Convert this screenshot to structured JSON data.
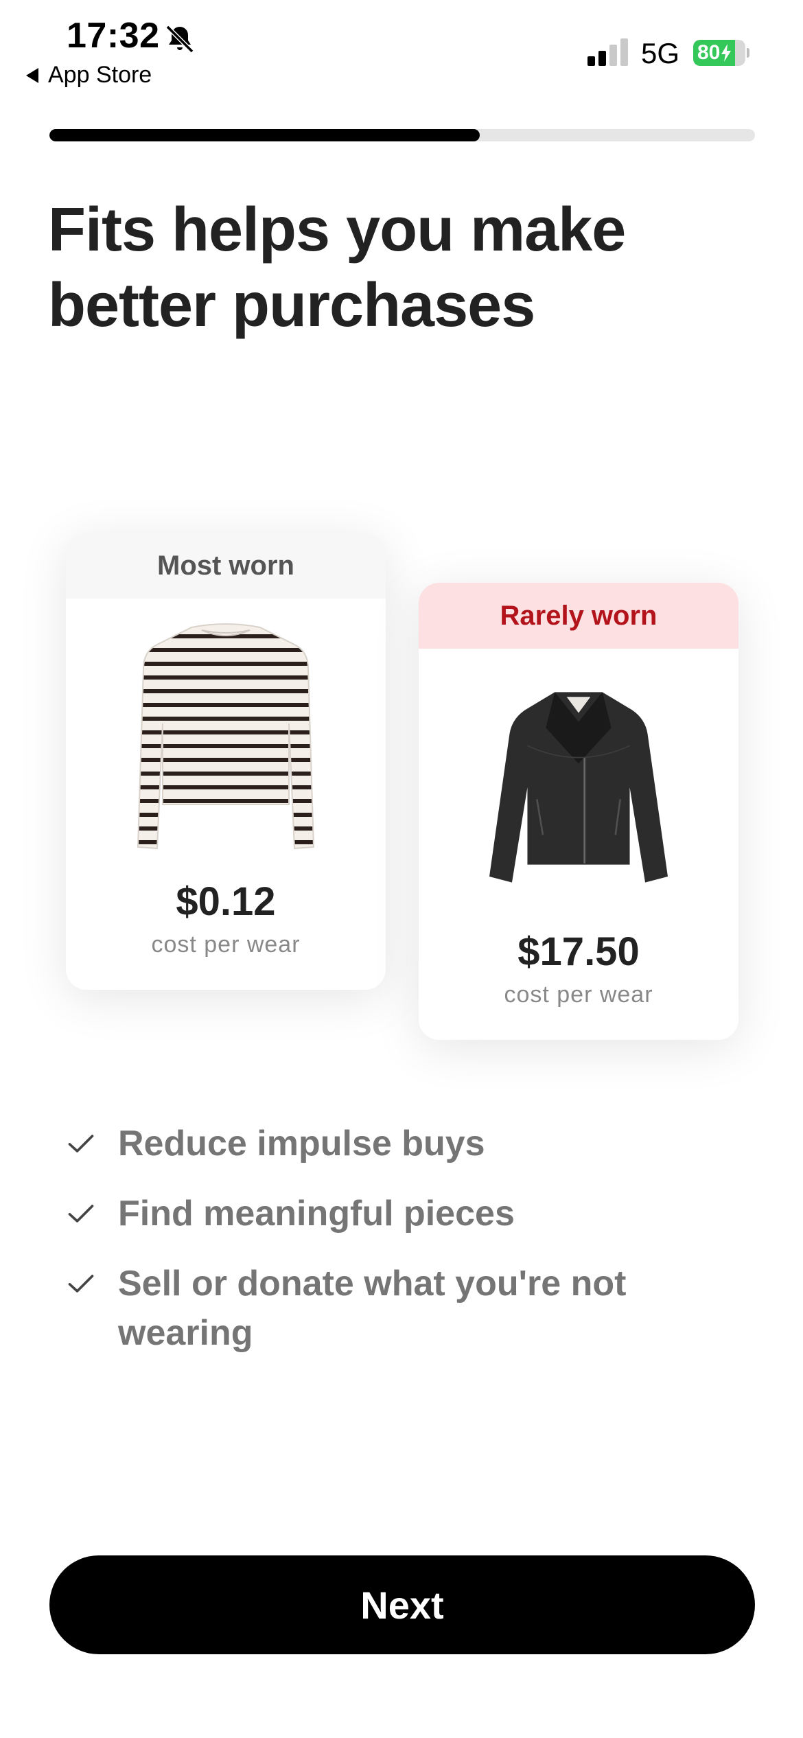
{
  "status_bar": {
    "time": "17:32",
    "back_label": "App Store",
    "network": "5G",
    "battery_percent": "80",
    "battery_level": 0.8,
    "battery_charging": true
  },
  "progress": {
    "fraction": 0.61
  },
  "title": "Fits helps you make better purchases",
  "cards": {
    "most_worn": {
      "label": "Most worn",
      "price": "$0.12",
      "caption": "cost per wear",
      "image": "striped-long-sleeve-top"
    },
    "rarely_worn": {
      "label": "Rarely worn",
      "price": "$17.50",
      "caption": "cost per wear",
      "image": "black-leather-jacket"
    }
  },
  "benefits": [
    "Reduce impulse buys",
    "Find meaningful pieces",
    "Sell or donate what you're not wearing"
  ],
  "next_button": {
    "label": "Next"
  },
  "colors": {
    "accent_red": "#b3141c",
    "rarely_header_bg": "#fde0e1",
    "button_bg": "#000000",
    "battery_green": "#34c759"
  },
  "icons": {
    "bell": "bell-slash-icon",
    "signal": "cellular-signal-icon",
    "check": "checkmark-icon",
    "back": "back-triangle-icon"
  }
}
